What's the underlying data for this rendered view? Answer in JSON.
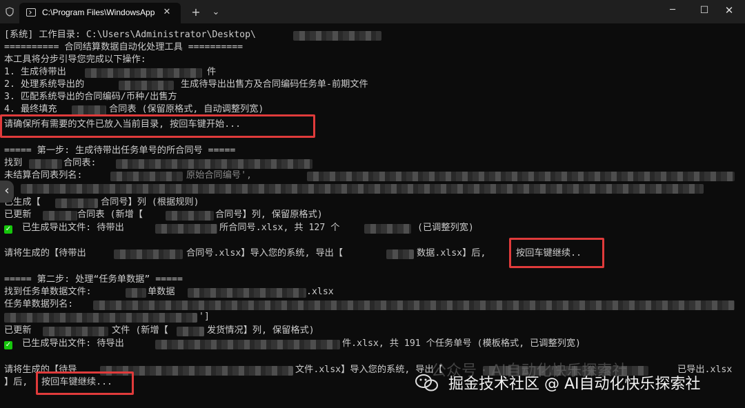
{
  "window": {
    "tab_title": "C:\\Program Files\\WindowsApps\\Microsoft.WindowsTerminal",
    "tab_close": "✕",
    "new_tab": "+",
    "dropdown": "⌄",
    "minimize": "─",
    "maximize": "☐",
    "close": "✕"
  },
  "icons": {
    "shield": "shield-icon",
    "terminal": "terminal-tab-icon",
    "check": "checkmark-icon",
    "side_arrow": "chevron-left-icon",
    "watermark_logo": "wechat-logo-icon"
  },
  "colors": {
    "background": "#0c0c0c",
    "text": "#cccccc",
    "highlight_box": "#e03b3b",
    "check": "#16c60c"
  },
  "terminal": {
    "l1": "[系统] 工作目录: C:\\Users\\Administrator\\Desktop\\",
    "l2": "========== 合同结算数据自动化处理工具 ==========",
    "l3": "本工具将分步引导您完成以下操作:",
    "l4a": "1. 生成待带出",
    "l4b": "件",
    "l5a": "2. 处理系统导出的",
    "l5b": "生成待导出出售方及合同编码任务单-前期文件",
    "l6": "3. 匹配系统导出的合同编码/币种/出售方",
    "l7a": "4. 最终填充",
    "l7b": "合同表 (保留原格式, 自动调整列宽)",
    "l8": "请确保所有需要的文件已放入当前目录, 按回车键开始...",
    "l10": "===== 第一步: 生成待带出任务单号的所合同号 =====",
    "l11": "找到",
    "l11b": "合同表:",
    "l12": "未结算合同表列名:",
    "l12b": "原始合同编号',",
    "l14a": "已生成【",
    "l14b": "合同号】列 (根据规则)",
    "l15a": "已更新",
    "l15b": "合同表 (新增【",
    "l15c": "合同号】列, 保留原格式)",
    "l16a": "已生成导出文件: 待带出",
    "l16b": "所合同号.xlsx, 共 127 个",
    "l16c": "(已调整列宽)",
    "l18a": "请将生成的【待带出",
    "l18b": "合同号.xlsx】导入您的系统, 导出【",
    "l18c": "数据.xlsx】后,",
    "l18d": "按回车键继续..",
    "l20": "===== 第二步: 处理“任务单数据” =====",
    "l21a": "找到任务单数据文件:",
    "l21b": "单数据",
    "l21c": ".xlsx",
    "l22": "任务单数据列名:",
    "l23": "']",
    "l24a": "已更新",
    "l24b": "文件 (新增【",
    "l24c": "发货情况】列, 保留格式)",
    "l25a": "已生成导出文件: 待导出",
    "l25b": "件.xlsx, 共 191 个任务单号 (模板格式, 已调整列宽)",
    "l27a": "请将生成的【待导",
    "l27b": "文件.xlsx】导入您的系统, 导出【",
    "l27c": "已导出.xlsx",
    "l28a": "】后,",
    "l28b": "按回车键继续..."
  },
  "watermark": {
    "text": "掘金技术社区 @ AI自动化快乐探索社",
    "ghost": "公众号 · AI自动化快乐探索社"
  }
}
